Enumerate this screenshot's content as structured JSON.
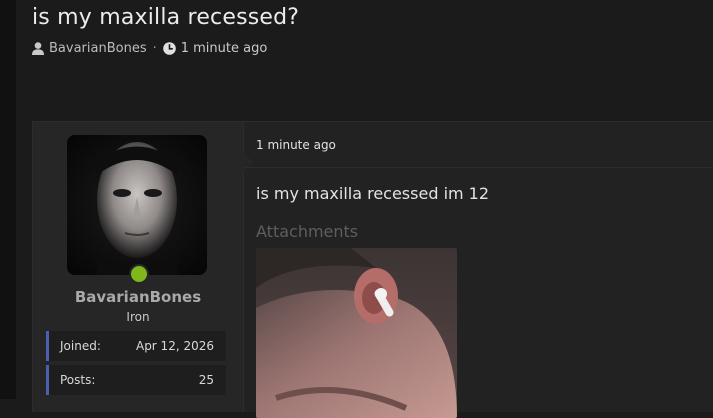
{
  "thread": {
    "title": "is my maxilla recessed?",
    "author": "BavarianBones",
    "separator": "·",
    "time": "1 minute ago"
  },
  "post": {
    "user": {
      "username": "BavarianBones",
      "rank": "Iron",
      "online": true,
      "stats": [
        {
          "label": "Joined:",
          "value": "Apr 12, 2026"
        },
        {
          "label": "Posts:",
          "value": "25"
        }
      ]
    },
    "timestamp": "1 minute ago",
    "body": "is my maxilla recessed im 12",
    "attachments_label": "Attachments"
  },
  "icons": {
    "author": "user-icon",
    "time": "clock-icon"
  },
  "colors": {
    "background": "#1b1b1b",
    "online": "#7fb71c",
    "stat_accent": "#4a5fb0"
  }
}
